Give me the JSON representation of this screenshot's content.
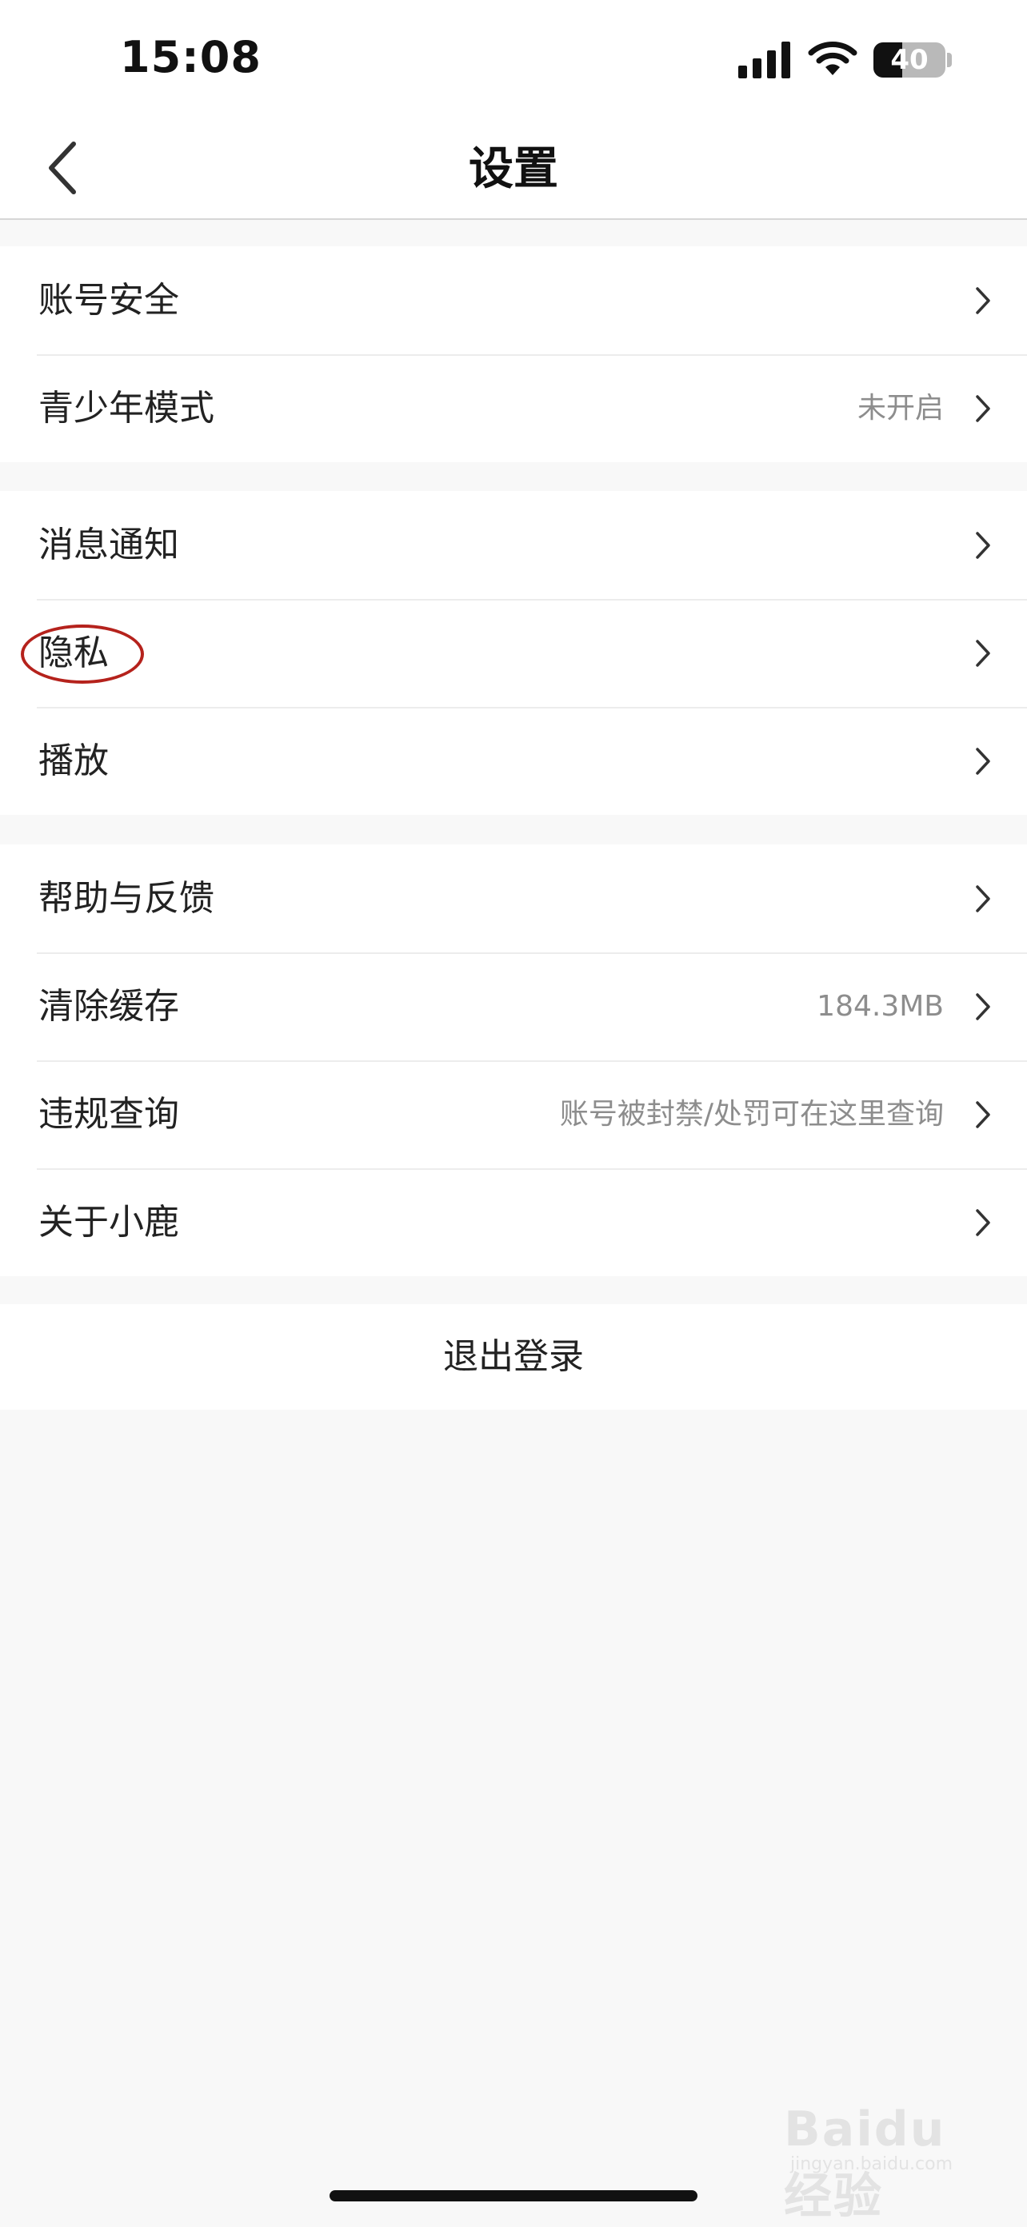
{
  "status_bar": {
    "time": "15:08",
    "battery_level": "40",
    "battery_fraction": 0.4,
    "icons": [
      "signal-icon",
      "wifi-icon",
      "battery-icon"
    ]
  },
  "nav": {
    "title": "设置",
    "back_icon": "chevron-left-icon"
  },
  "groups": [
    {
      "items": [
        {
          "label": "账号安全",
          "value": ""
        },
        {
          "label": "青少年模式",
          "value": "未开启"
        }
      ]
    },
    {
      "items": [
        {
          "label": "消息通知",
          "value": ""
        },
        {
          "label": "隐私",
          "value": "",
          "highlighted": true
        },
        {
          "label": "播放",
          "value": ""
        }
      ]
    },
    {
      "items": [
        {
          "label": "帮助与反馈",
          "value": ""
        },
        {
          "label": "清除缓存",
          "value": "184.3MB"
        },
        {
          "label": "违规查询",
          "value": "账号被封禁/处罚可在这里查询"
        },
        {
          "label": "关于小鹿",
          "value": ""
        }
      ]
    }
  ],
  "logout": {
    "label": "退出登录"
  },
  "watermark": {
    "logo": "Baidu经验",
    "sub": "jingyan.baidu.com"
  },
  "colors": {
    "highlight_ring": "#b5221c",
    "page_background": "#f8f8f8",
    "value_text": "#8d8d8d"
  }
}
